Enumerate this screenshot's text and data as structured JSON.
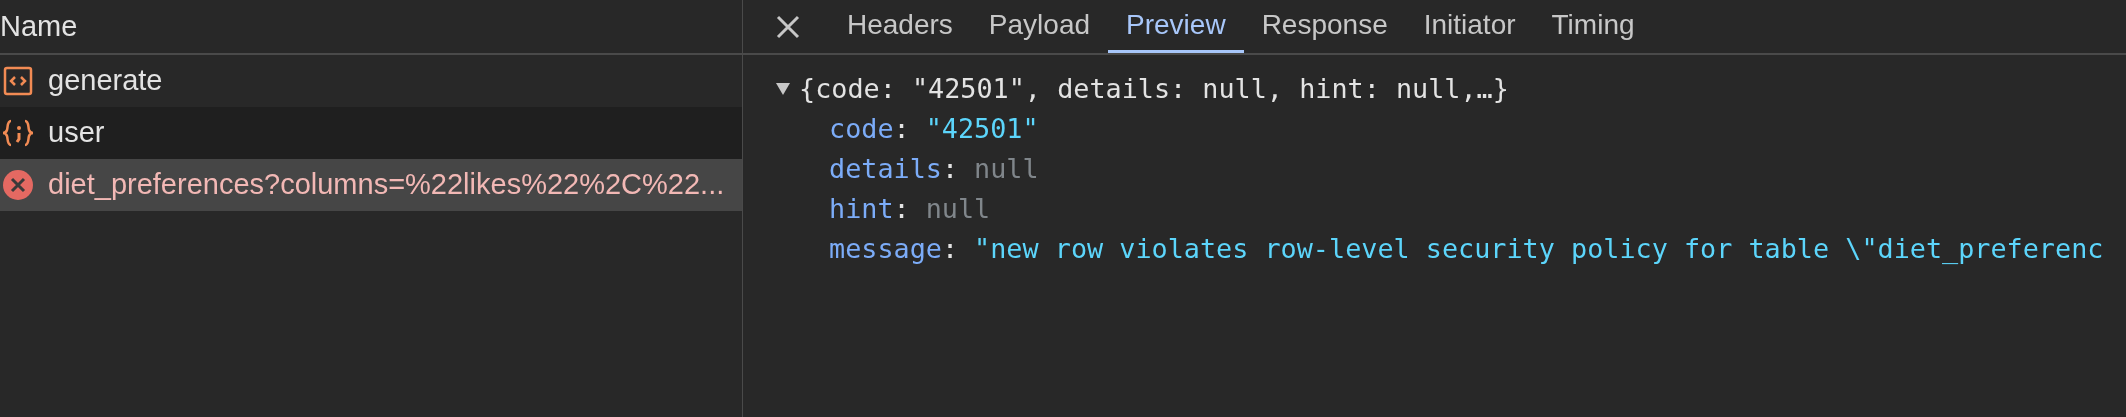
{
  "requests": {
    "column": "Name",
    "rows": [
      {
        "name": "generate",
        "kind": "document",
        "selected": false
      },
      {
        "name": "user",
        "kind": "script",
        "selected": false
      },
      {
        "name": "diet_preferences?columns=%22likes%22%2C%22...",
        "kind": "error",
        "selected": true
      }
    ]
  },
  "details": {
    "tabs": [
      {
        "label": "Headers",
        "selected": false
      },
      {
        "label": "Payload",
        "selected": false
      },
      {
        "label": "Preview",
        "selected": true
      },
      {
        "label": "Response",
        "selected": false
      },
      {
        "label": "Initiator",
        "selected": false
      },
      {
        "label": "Timing",
        "selected": false
      }
    ],
    "preview": {
      "summary": "{code: \"42501\", details: null, hint: null,…}",
      "expanded": true,
      "properties": [
        {
          "key": "code",
          "separator": ":",
          "value": "\"42501\"",
          "kind": "string"
        },
        {
          "key": "details",
          "separator": ":",
          "value": "null",
          "kind": "null"
        },
        {
          "key": "hint",
          "separator": ":",
          "value": "null",
          "kind": "null"
        },
        {
          "key": "message",
          "separator": ":",
          "value": "\"new row violates row-level security policy for table \\\"diet_preferenc",
          "kind": "string"
        }
      ]
    }
  }
}
